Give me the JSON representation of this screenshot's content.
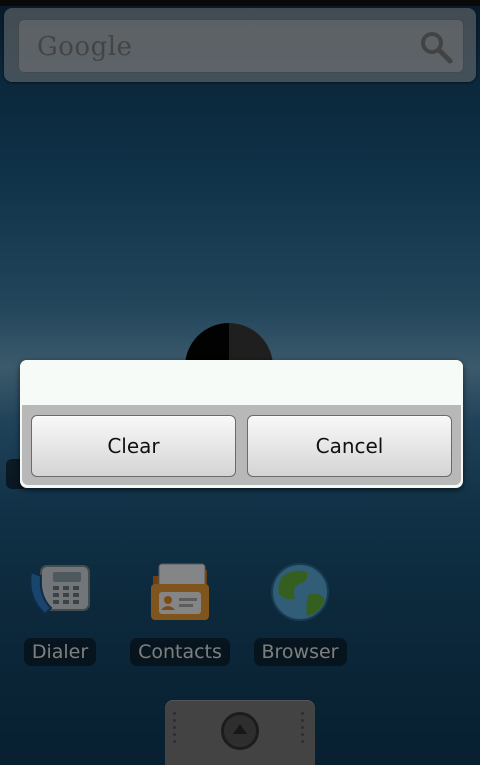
{
  "search": {
    "logo_text": "Google",
    "icon": "search-icon"
  },
  "apps": [
    {
      "label": "Dialer",
      "icon": "phone-icon"
    },
    {
      "label": "Contacts",
      "icon": "contacts-icon"
    },
    {
      "label": "Browser",
      "icon": "globe-icon"
    }
  ],
  "dialog": {
    "buttons": {
      "clear_label": "Clear",
      "cancel_label": "Cancel"
    }
  },
  "drawer": {
    "icon": "drawer-up-icon"
  },
  "colors": {
    "dialog_bg": "#f4f8f5",
    "button_bar": "#b8b8b8",
    "label_text": "#e6e6e6"
  }
}
